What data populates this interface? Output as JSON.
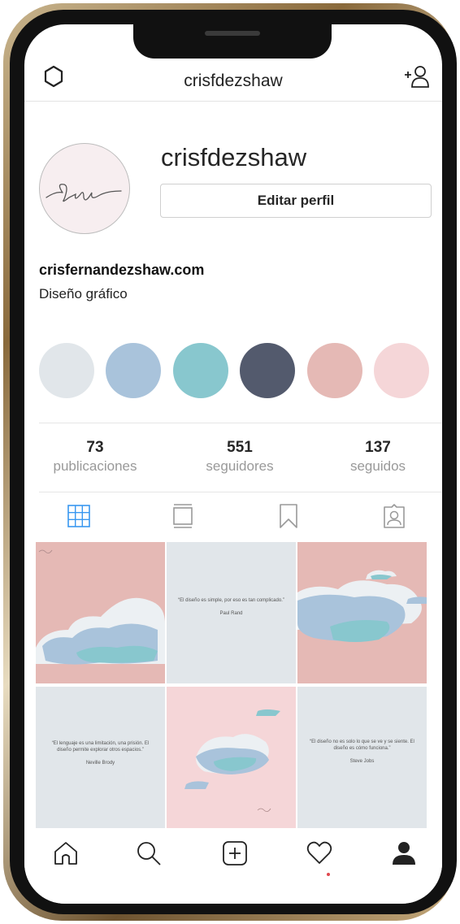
{
  "header": {
    "username": "crisfdezshaw",
    "settings_icon": "gear-icon",
    "add_icon": "add-person-icon"
  },
  "profile": {
    "name": "crisfdezshaw",
    "edit_button": "Editar perfil",
    "website": "crisfernandezshaw.com",
    "bio": "Diseño gráfico",
    "avatar_text": "Cris"
  },
  "highlights": [
    "#e1e6ea",
    "#a9c3db",
    "#88c7ce",
    "#535a6d",
    "#e5b9b5",
    "#f5d6d8"
  ],
  "stats": [
    {
      "value": "73",
      "label": "publicaciones"
    },
    {
      "value": "551",
      "label": "seguidores"
    },
    {
      "value": "137",
      "label": "seguidos"
    }
  ],
  "tabs": [
    "grid-icon",
    "feed-icon",
    "saved-icon",
    "tagged-icon"
  ],
  "posts": {
    "quote1": "“El diseño es simple, por eso es tan complicado.”",
    "author1": "Paul Rand",
    "quote2": "“El lenguaje es una limitación, una prisión. El diseño permite explorar otros espacios.”",
    "author2": "Neville Brody",
    "quote3": "“El diseño no es solo lo que se ve y se siente. El diseño es cómo funciona.”",
    "author3": "Steve Jobs",
    "signature": "Cris"
  },
  "bottom_nav": [
    "home-icon",
    "search-icon",
    "new-post-icon",
    "heart-icon",
    "profile-icon"
  ],
  "colors": {
    "accent": "#3897f0",
    "pink": "#e5b9b5",
    "light_pink": "#f5d6d8",
    "grey": "#e1e6ea",
    "notification": "#e0484e"
  }
}
